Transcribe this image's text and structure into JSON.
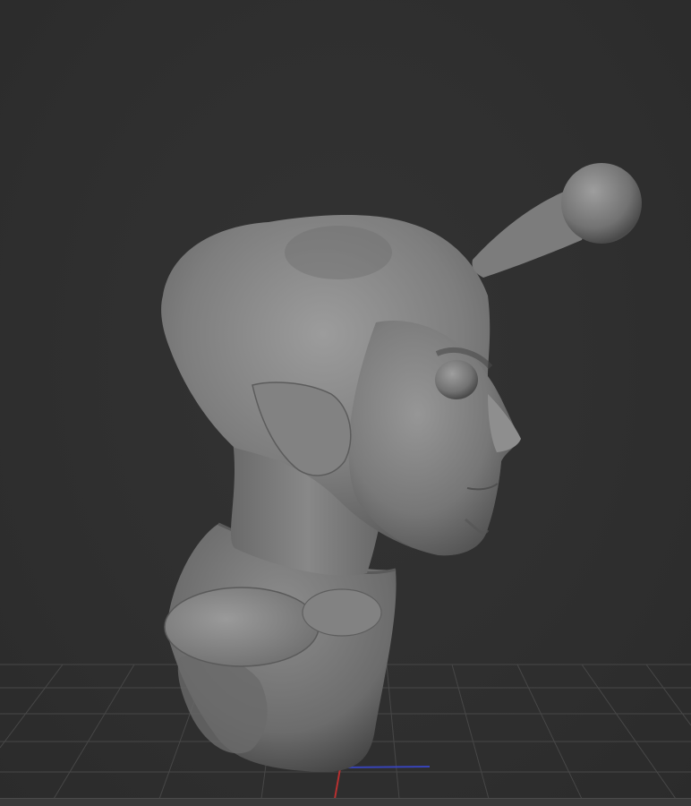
{
  "colors": {
    "background": "#2e2e2e",
    "grid_line": "#4a4a4a",
    "sculpt_base": "#8a8a8a",
    "sculpt_shadow": "#4e4e4e",
    "sculpt_highlight": "#a8a8a8",
    "axis_x": "#c03030",
    "axis_z": "#3040c0"
  },
  "viewport": {
    "model": "sculpt-mesh",
    "floor_grid": "visible",
    "gizmo_axes": [
      "x",
      "z"
    ]
  }
}
